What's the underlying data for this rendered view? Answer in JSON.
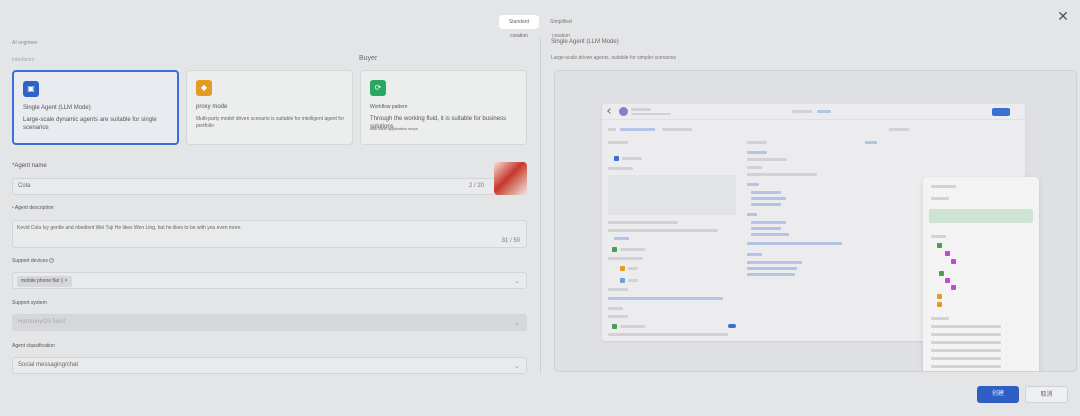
{
  "tabs": {
    "standard": "Standard creation",
    "simple": "Simplified creation"
  },
  "left": {
    "section_label": "AI engineer",
    "sub_label": "Interfaces",
    "buyer_label": "Buyer",
    "cards": [
      {
        "title": "Single Agent (LLM Mode)",
        "desc": "Large-scale dynamic agents are suitable for single scenarios",
        "color": "#2b63c9"
      },
      {
        "title": "proxy mode",
        "desc": "Multi-party model driven scenario is suitable for intelligent agent for portfolio",
        "color": "#e59a22"
      },
      {
        "title": "Workflow pattern",
        "desc": "Through the working fluid, it is suitable for business solutions",
        "color": "#2aa761",
        "desc2": "with clear application steps"
      }
    ],
    "agent_name": {
      "label": "*Agent name",
      "value": "Cola",
      "count": "2 / 20"
    },
    "agent_desc": {
      "label": "Agent description",
      "value": "Kevid Cola Ivy gentle and obedient Wei Tuji He likes Wen Ling, but he likes to be with you even more.",
      "count": "31 / 50"
    },
    "support_device": {
      "label": "Support devices",
      "chip": "mobile phone flat"
    },
    "support_system": {
      "label": "Support system",
      "value": "HarmonyOS Next"
    },
    "agent_class": {
      "label": "Agent classification",
      "value": "Social messaging/chat"
    }
  },
  "right": {
    "title": "Single Agent (LLM Mode)",
    "subtitle": "Large-scale driven agents, suitable for simpler scenarios"
  },
  "footer": {
    "primary": "创建",
    "secondary": "取消"
  }
}
